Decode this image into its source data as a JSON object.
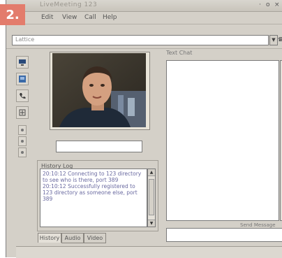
{
  "badge": "2.",
  "window": {
    "title": "LiveMeeting 123",
    "controls": [
      "×",
      "·",
      "o"
    ]
  },
  "menu": [
    "Edit",
    "View",
    "Call",
    "Help"
  ],
  "address": {
    "value": "Lattice"
  },
  "history": {
    "label": "History Log",
    "text": "20:10:12 Connecting to 123 directory to see who is there, port 389\n20:10:12 Successfully registered to 123 directory as someone else, port 389"
  },
  "tabs": [
    "History",
    "Audio",
    "Video"
  ],
  "text_chat": {
    "label": "Text Chat",
    "send_label": "Send Message"
  },
  "colors": {
    "badge": "#e37c6c",
    "window_bg": "#d4d0c8",
    "history_text": "#6a6aa0"
  }
}
